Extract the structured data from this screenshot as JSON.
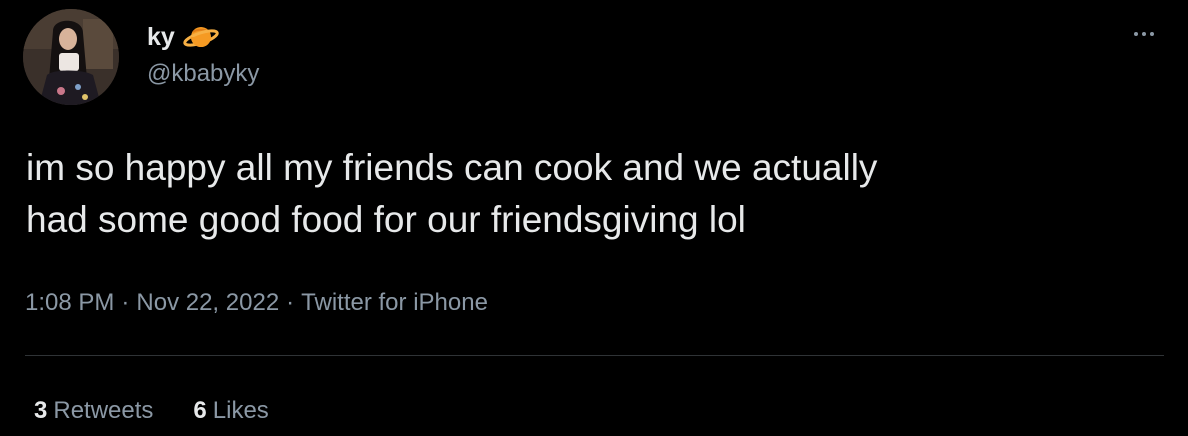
{
  "author": {
    "display_name": "ky",
    "name_emoji": "ringed-planet-icon",
    "handle": "@kbabyky"
  },
  "tweet": {
    "text": "im so happy all my friends can cook and we actually\nhad some good food for our friendsgiving lol"
  },
  "meta": {
    "time": "1:08 PM",
    "separator": "·",
    "date": "Nov 22, 2022",
    "source": "Twitter for iPhone"
  },
  "stats": {
    "retweets_count": "3",
    "retweets_label": "Retweets",
    "likes_count": "6",
    "likes_label": "Likes"
  },
  "colors": {
    "background": "#000000",
    "primary_text": "#e7e9ea",
    "secondary_text": "#8b98a5",
    "divider": "#2f3336",
    "planet_orange": "#f59a23"
  }
}
